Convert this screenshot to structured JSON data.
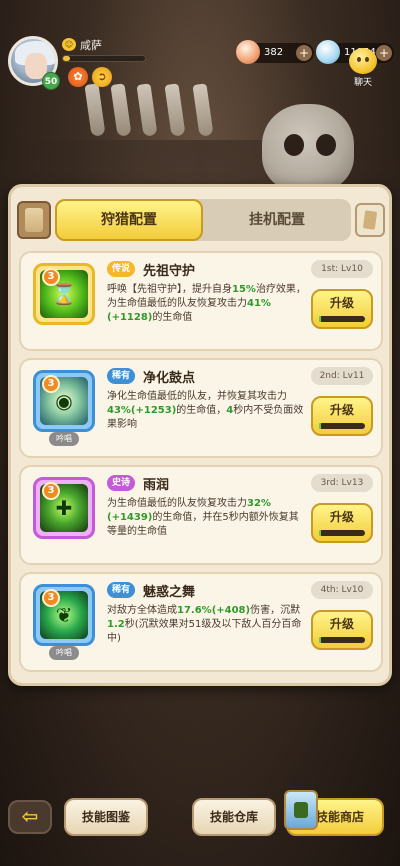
{
  "player": {
    "name": "咸萨",
    "level": "50",
    "exp_fraction": 0.08
  },
  "resources": {
    "gems": "382",
    "pearls": "11854"
  },
  "chat": {
    "label": "聊天"
  },
  "tabs": {
    "active": "狩猎配置",
    "inactive": "挂机配置"
  },
  "skills": [
    {
      "stars": "3",
      "rarity": "传说",
      "name": "先祖守护",
      "slot": "1st: Lv10",
      "chant": "",
      "desc": [
        "呼唤【先祖守护】，提升自身",
        "15%",
        "治疗效果，为生命值最低的队友恢复攻击力",
        "41%(+1128)",
        "的生命值"
      ],
      "upgrade_label": "升级",
      "progress": 0.05
    },
    {
      "stars": "3",
      "rarity": "稀有",
      "name": "净化鼓点",
      "slot": "2nd: Lv11",
      "chant": "吟唱",
      "desc": [
        "净化生命值最低的队友，并恢复其攻击力",
        "43%(+1253)",
        "的生命值，",
        "4",
        "秒内不受负面效果影响"
      ],
      "upgrade_label": "升级",
      "progress": 0.05
    },
    {
      "stars": "3",
      "rarity": "史诗",
      "name": "雨润",
      "slot": "3rd: Lv13",
      "chant": "",
      "desc": [
        "为生命值最低的队友恢复攻击力",
        "32%(+1439)",
        "的生命值，并在5秒内额外恢复其等量的生命值",
        "",
        ""
      ],
      "upgrade_label": "升级",
      "progress": 0.05
    },
    {
      "stars": "3",
      "rarity": "稀有",
      "name": "魅惑之舞",
      "slot": "4th: Lv10",
      "chant": "吟唱",
      "desc": [
        "对敌方全体造成",
        "17.6%(+408)",
        "伤害，沉默",
        "1.2",
        "秒(沉默效果对51级及以下敌人百分百命中)"
      ],
      "upgrade_label": "升级",
      "progress": 0.05
    }
  ],
  "bottom": {
    "back": "⇦",
    "codex": "技能图鉴",
    "storage": "技能仓库",
    "shop": "技能商店"
  },
  "colors": {
    "accent_yellow": "#f3cc3a",
    "legend": "#f4b82a",
    "rare": "#3d8fd6",
    "epic": "#c55ad6",
    "value_green": "#2f9a2a"
  }
}
